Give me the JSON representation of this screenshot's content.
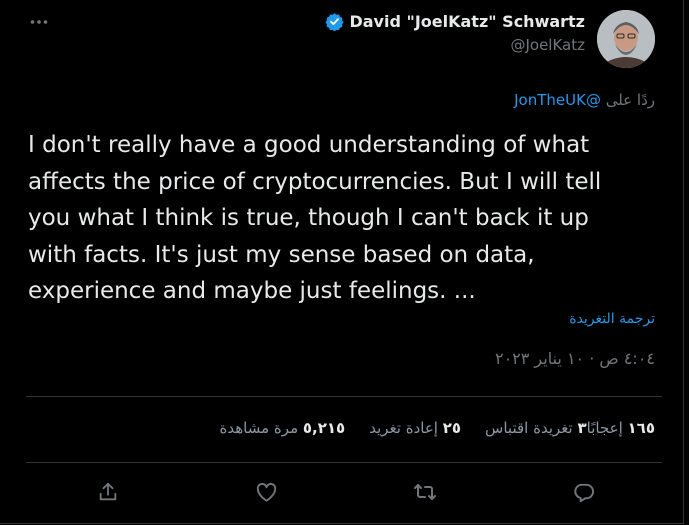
{
  "tweet": {
    "author": {
      "display_name": "David \"JoelKatz\" Schwartz",
      "handle": "@JoelKatz",
      "verified": true
    },
    "reply_to": {
      "prefix": "ردًا على",
      "mention": "@JonTheUK"
    },
    "text": "I don't really have a good understanding of what\naffects the price of cryptocurrencies. But I will tell\nyou what I think is true, though I can't back it up\nwith facts. It's just my sense based on data,\nexperience and maybe just feelings. ...",
    "translate_label": "ترجمة التغريدة",
    "timestamp": "٤:٠٤ ص · ١٠ يناير ٢٠٢٣",
    "stats": {
      "views": {
        "count": "٥,٢١٥",
        "label": "مرة مشاهدة"
      },
      "retweets": {
        "count": "٢٥",
        "label": "إعادة تغريد"
      },
      "quotes": {
        "count": "٣",
        "label": "تغريدة اقتباس"
      },
      "likes": {
        "count": "١٦٥",
        "label": "إعجابًا"
      }
    }
  },
  "icons": {
    "more": "more-horizontal-icon",
    "verified": "verified-badge-icon",
    "share": "share-icon",
    "like": "heart-icon",
    "retweet": "retweet-icon",
    "reply": "reply-icon"
  },
  "colors": {
    "background": "#000000",
    "text": "#e7e9ea",
    "secondary": "#71767b",
    "accent": "#1d9bf0",
    "divider": "#2f3336"
  }
}
